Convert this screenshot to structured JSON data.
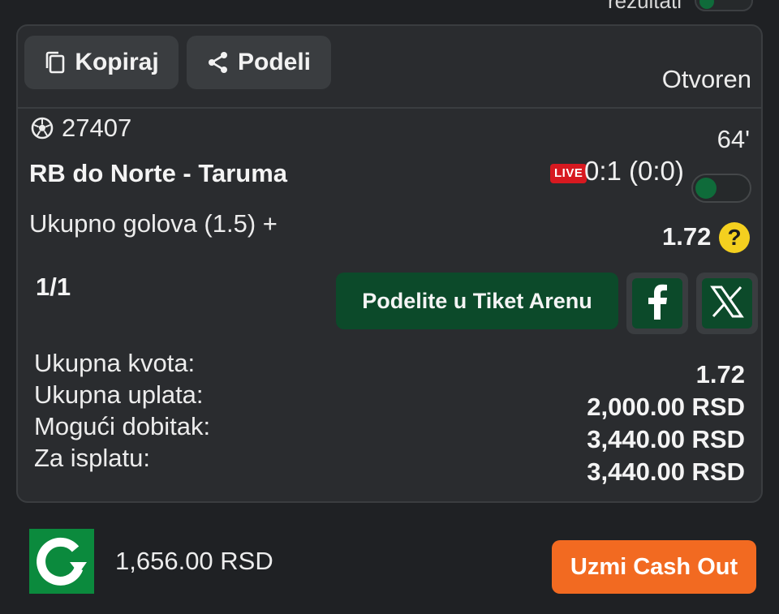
{
  "top_strip": {
    "partial_label": "rezultati"
  },
  "ticket": {
    "copy_label": "Kopiraj",
    "share_label": "Podeli",
    "status": "Otvoren",
    "match": {
      "code": "27407",
      "minute": "64'",
      "teams": "RB do Norte - Taruma",
      "live_badge": "LIVE",
      "score": "0:1 (0:0)",
      "market": "Ukupno golova (1.5) +",
      "odds": "1.72",
      "help_label": "?"
    },
    "count": "1/1",
    "arena_label": "Podelite u Tiket Arenu",
    "summary": {
      "total_odds_label": "Ukupna kvota:",
      "total_odds_value": "1.72",
      "stake_label": "Ukupna uplata:",
      "stake_value": "2,000.00 RSD",
      "possible_win_label": "Mogući dobitak:",
      "possible_win_value": "3,440.00 RSD",
      "payout_label": "Za isplatu:",
      "payout_value": "3,440.00 RSD"
    }
  },
  "cashout": {
    "amount": "1,656.00 RSD",
    "button_label": "Uzmi Cash Out"
  },
  "colors": {
    "background": "#1f2124",
    "card": "#2a2c2f",
    "green": "#0c4a2a",
    "live_red": "#d71920",
    "cashout_orange": "#f26a21",
    "help_yellow": "#f4d01f"
  },
  "icons": [
    "copy-icon",
    "share-icon",
    "soccer-ball-icon",
    "help-icon",
    "facebook-icon",
    "x-icon",
    "cashout-logo-icon"
  ]
}
